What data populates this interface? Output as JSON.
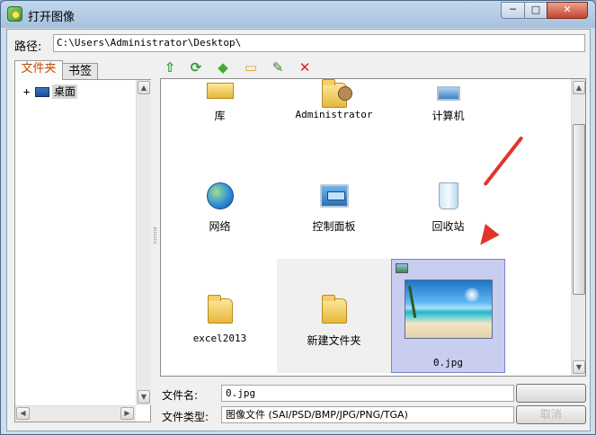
{
  "window": {
    "title": "打开图像",
    "min_glyph": "─",
    "max_glyph": "□",
    "close_glyph": "✕"
  },
  "path": {
    "label": "路径:",
    "value": "C:\\Users\\Administrator\\Desktop\\"
  },
  "tabs": [
    {
      "label": "文件夹",
      "active": true
    },
    {
      "label": "书签",
      "active": false
    }
  ],
  "tree": {
    "expander": "+",
    "root_label": "桌面"
  },
  "toolbar": [
    {
      "icon": "up-folder-icon",
      "glyph": "⇧",
      "color": "#2e9b2e"
    },
    {
      "icon": "refresh-icon",
      "glyph": "⟳",
      "color": "#2e9b2e"
    },
    {
      "icon": "bookmark-tag-icon",
      "glyph": "◆",
      "color": "#3fae2c"
    },
    {
      "icon": "new-folder-icon",
      "glyph": "▭",
      "color": "#d6a12d"
    },
    {
      "icon": "rename-icon",
      "glyph": "✎",
      "color": "#3b7d2a"
    },
    {
      "icon": "delete-icon",
      "glyph": "✕",
      "color": "#e02020"
    }
  ],
  "files": [
    {
      "label": "库",
      "icon": "library-icon"
    },
    {
      "label": "Administrator",
      "icon": "user-folder-icon"
    },
    {
      "label": "计算机",
      "icon": "computer-icon"
    },
    {
      "label": "网络",
      "icon": "network-icon"
    },
    {
      "label": "控制面板",
      "icon": "control-panel-icon"
    },
    {
      "label": "回收站",
      "icon": "recycle-bin-icon"
    },
    {
      "label": "excel2013",
      "icon": "folder-icon"
    },
    {
      "label": "新建文件夹",
      "icon": "folder-icon"
    },
    {
      "label": "0.jpg",
      "icon": "image-thumbnail-icon",
      "selected": true
    }
  ],
  "form": {
    "filename_label": "文件名:",
    "filename_value": "0.jpg",
    "filetype_label": "文件类型:",
    "filetype_value": "图像文件 (SAI/PSD/BMP/JPG/PNG/TGA)",
    "cancel_label": "取消"
  },
  "colors": {
    "accent_red": "#e0352b",
    "selection": "#c9cdf0",
    "active_tab_text": "#c04b00"
  }
}
